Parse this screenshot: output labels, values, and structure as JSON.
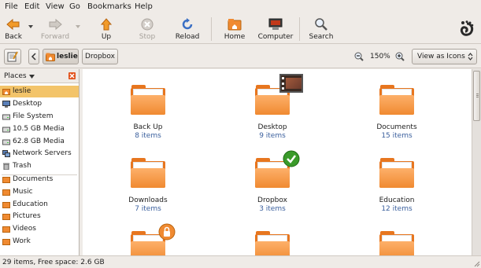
{
  "menubar": {
    "file": "File",
    "edit": "Edit",
    "view": "View",
    "go": "Go",
    "bookmarks": "Bookmarks",
    "help": "Help"
  },
  "toolbar": {
    "back": "Back",
    "forward": "Forward",
    "up": "Up",
    "stop": "Stop",
    "reload": "Reload",
    "home": "Home",
    "computer": "Computer",
    "search": "Search"
  },
  "location": {
    "current": "leslie",
    "next": "Dropbox",
    "zoom": "150%",
    "view_mode": "View as Icons"
  },
  "sidebar": {
    "header": "Places",
    "items": [
      {
        "label": "leslie",
        "icon": "home-folder-icon"
      },
      {
        "label": "Desktop",
        "icon": "desktop-icon"
      },
      {
        "label": "File System",
        "icon": "drive-icon"
      },
      {
        "label": "10.5 GB Media",
        "icon": "drive-icon"
      },
      {
        "label": "62.8 GB Media",
        "icon": "drive-icon"
      },
      {
        "label": "Network Servers",
        "icon": "network-icon"
      },
      {
        "label": "Trash",
        "icon": "trash-icon"
      },
      {
        "label": "Documents",
        "icon": "folder-icon"
      },
      {
        "label": "Music",
        "icon": "folder-icon"
      },
      {
        "label": "Education",
        "icon": "folder-icon"
      },
      {
        "label": "Pictures",
        "icon": "folder-icon"
      },
      {
        "label": "Videos",
        "icon": "folder-icon"
      },
      {
        "label": "Work",
        "icon": "folder-icon"
      }
    ]
  },
  "files": [
    {
      "name": "Back Up",
      "count": "8 items"
    },
    {
      "name": "Desktop",
      "count": "9 items",
      "emblem": "picture-emblem-icon"
    },
    {
      "name": "Documents",
      "count": "15 items"
    },
    {
      "name": "Downloads",
      "count": "7 items"
    },
    {
      "name": "Dropbox",
      "count": "3 items",
      "emblem": "check-emblem-icon"
    },
    {
      "name": "Education",
      "count": "12 items"
    },
    {
      "name": "",
      "count": "",
      "emblem": "lock-emblem-icon"
    },
    {
      "name": "",
      "count": ""
    },
    {
      "name": "",
      "count": ""
    }
  ],
  "status": {
    "text": "29 items, Free space: 2.6 GB"
  },
  "colors": {
    "folder": "#f08a31",
    "selection": "#f3c46a",
    "count_text": "#3a5f9d"
  }
}
